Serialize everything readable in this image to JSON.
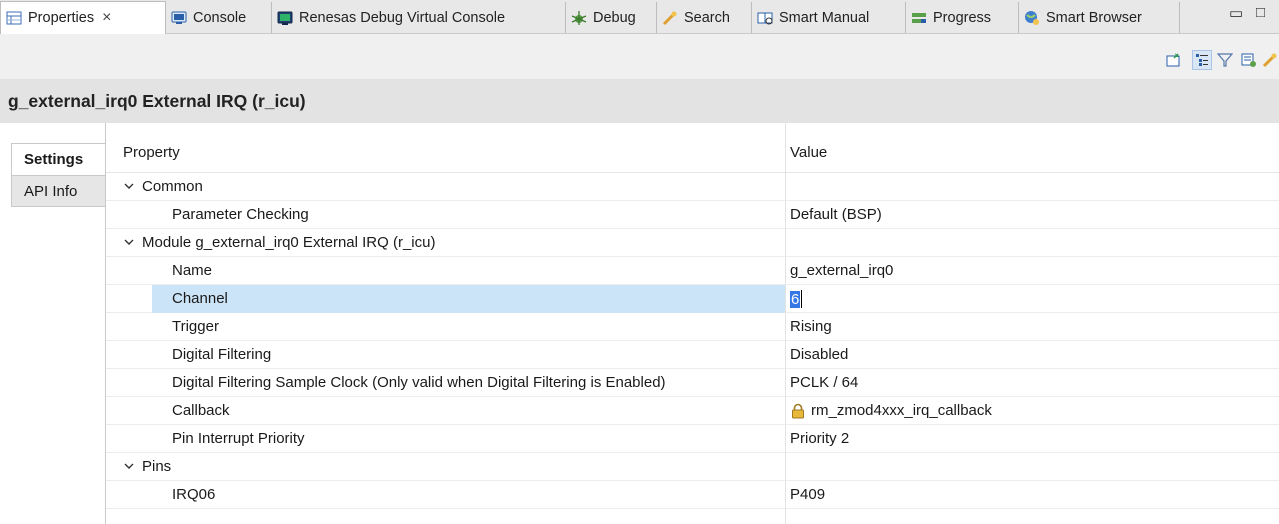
{
  "tabs": [
    {
      "label": "Properties",
      "icon": "properties-icon",
      "active": true
    },
    {
      "label": "Console",
      "icon": "console-icon"
    },
    {
      "label": "Renesas Debug Virtual Console",
      "icon": "virtual-console-icon"
    },
    {
      "label": "Debug",
      "icon": "debug-icon"
    },
    {
      "label": "Search",
      "icon": "search-icon"
    },
    {
      "label": "Smart Manual",
      "icon": "smart-manual-icon"
    },
    {
      "label": "Progress",
      "icon": "progress-icon"
    },
    {
      "label": "Smart Browser",
      "icon": "smart-browser-icon"
    }
  ],
  "tab_close_glyph": "×",
  "window_controls": {
    "minimize": "▭",
    "maximize": "□"
  },
  "toolbar": {
    "icons": [
      "pin-to-view-icon",
      "show-categories-icon",
      "filter-icon",
      "restore-defaults-icon",
      "search-icon",
      "view-menu-icon"
    ]
  },
  "title": "g_external_irq0 External IRQ (r_icu)",
  "side_tabs": {
    "settings": "Settings",
    "api_info": "API Info"
  },
  "table": {
    "header": {
      "property": "Property",
      "value": "Value"
    },
    "rows": [
      {
        "name": "Common",
        "value": "",
        "group": true
      },
      {
        "name": "Parameter Checking",
        "value": "Default (BSP)"
      },
      {
        "name": "Module g_external_irq0 External IRQ (r_icu)",
        "value": "",
        "group": true
      },
      {
        "name": "Name",
        "value": "g_external_irq0"
      },
      {
        "name": "Channel",
        "value": "6",
        "selected": true,
        "editing": true
      },
      {
        "name": "Trigger",
        "value": "Rising"
      },
      {
        "name": "Digital Filtering",
        "value": "Disabled"
      },
      {
        "name": "Digital Filtering Sample Clock (Only valid when Digital Filtering is Enabled)",
        "value": "PCLK / 64"
      },
      {
        "name": "Callback",
        "value": "rm_zmod4xxx_irq_callback",
        "locked": true
      },
      {
        "name": "Pin Interrupt Priority",
        "value": "Priority 2"
      },
      {
        "name": "Pins",
        "value": "",
        "group": true
      },
      {
        "name": "IRQ06",
        "value": "P409"
      }
    ]
  },
  "colors": {
    "selection": "#cce4f7",
    "edit_highlight": "#3578e5"
  }
}
